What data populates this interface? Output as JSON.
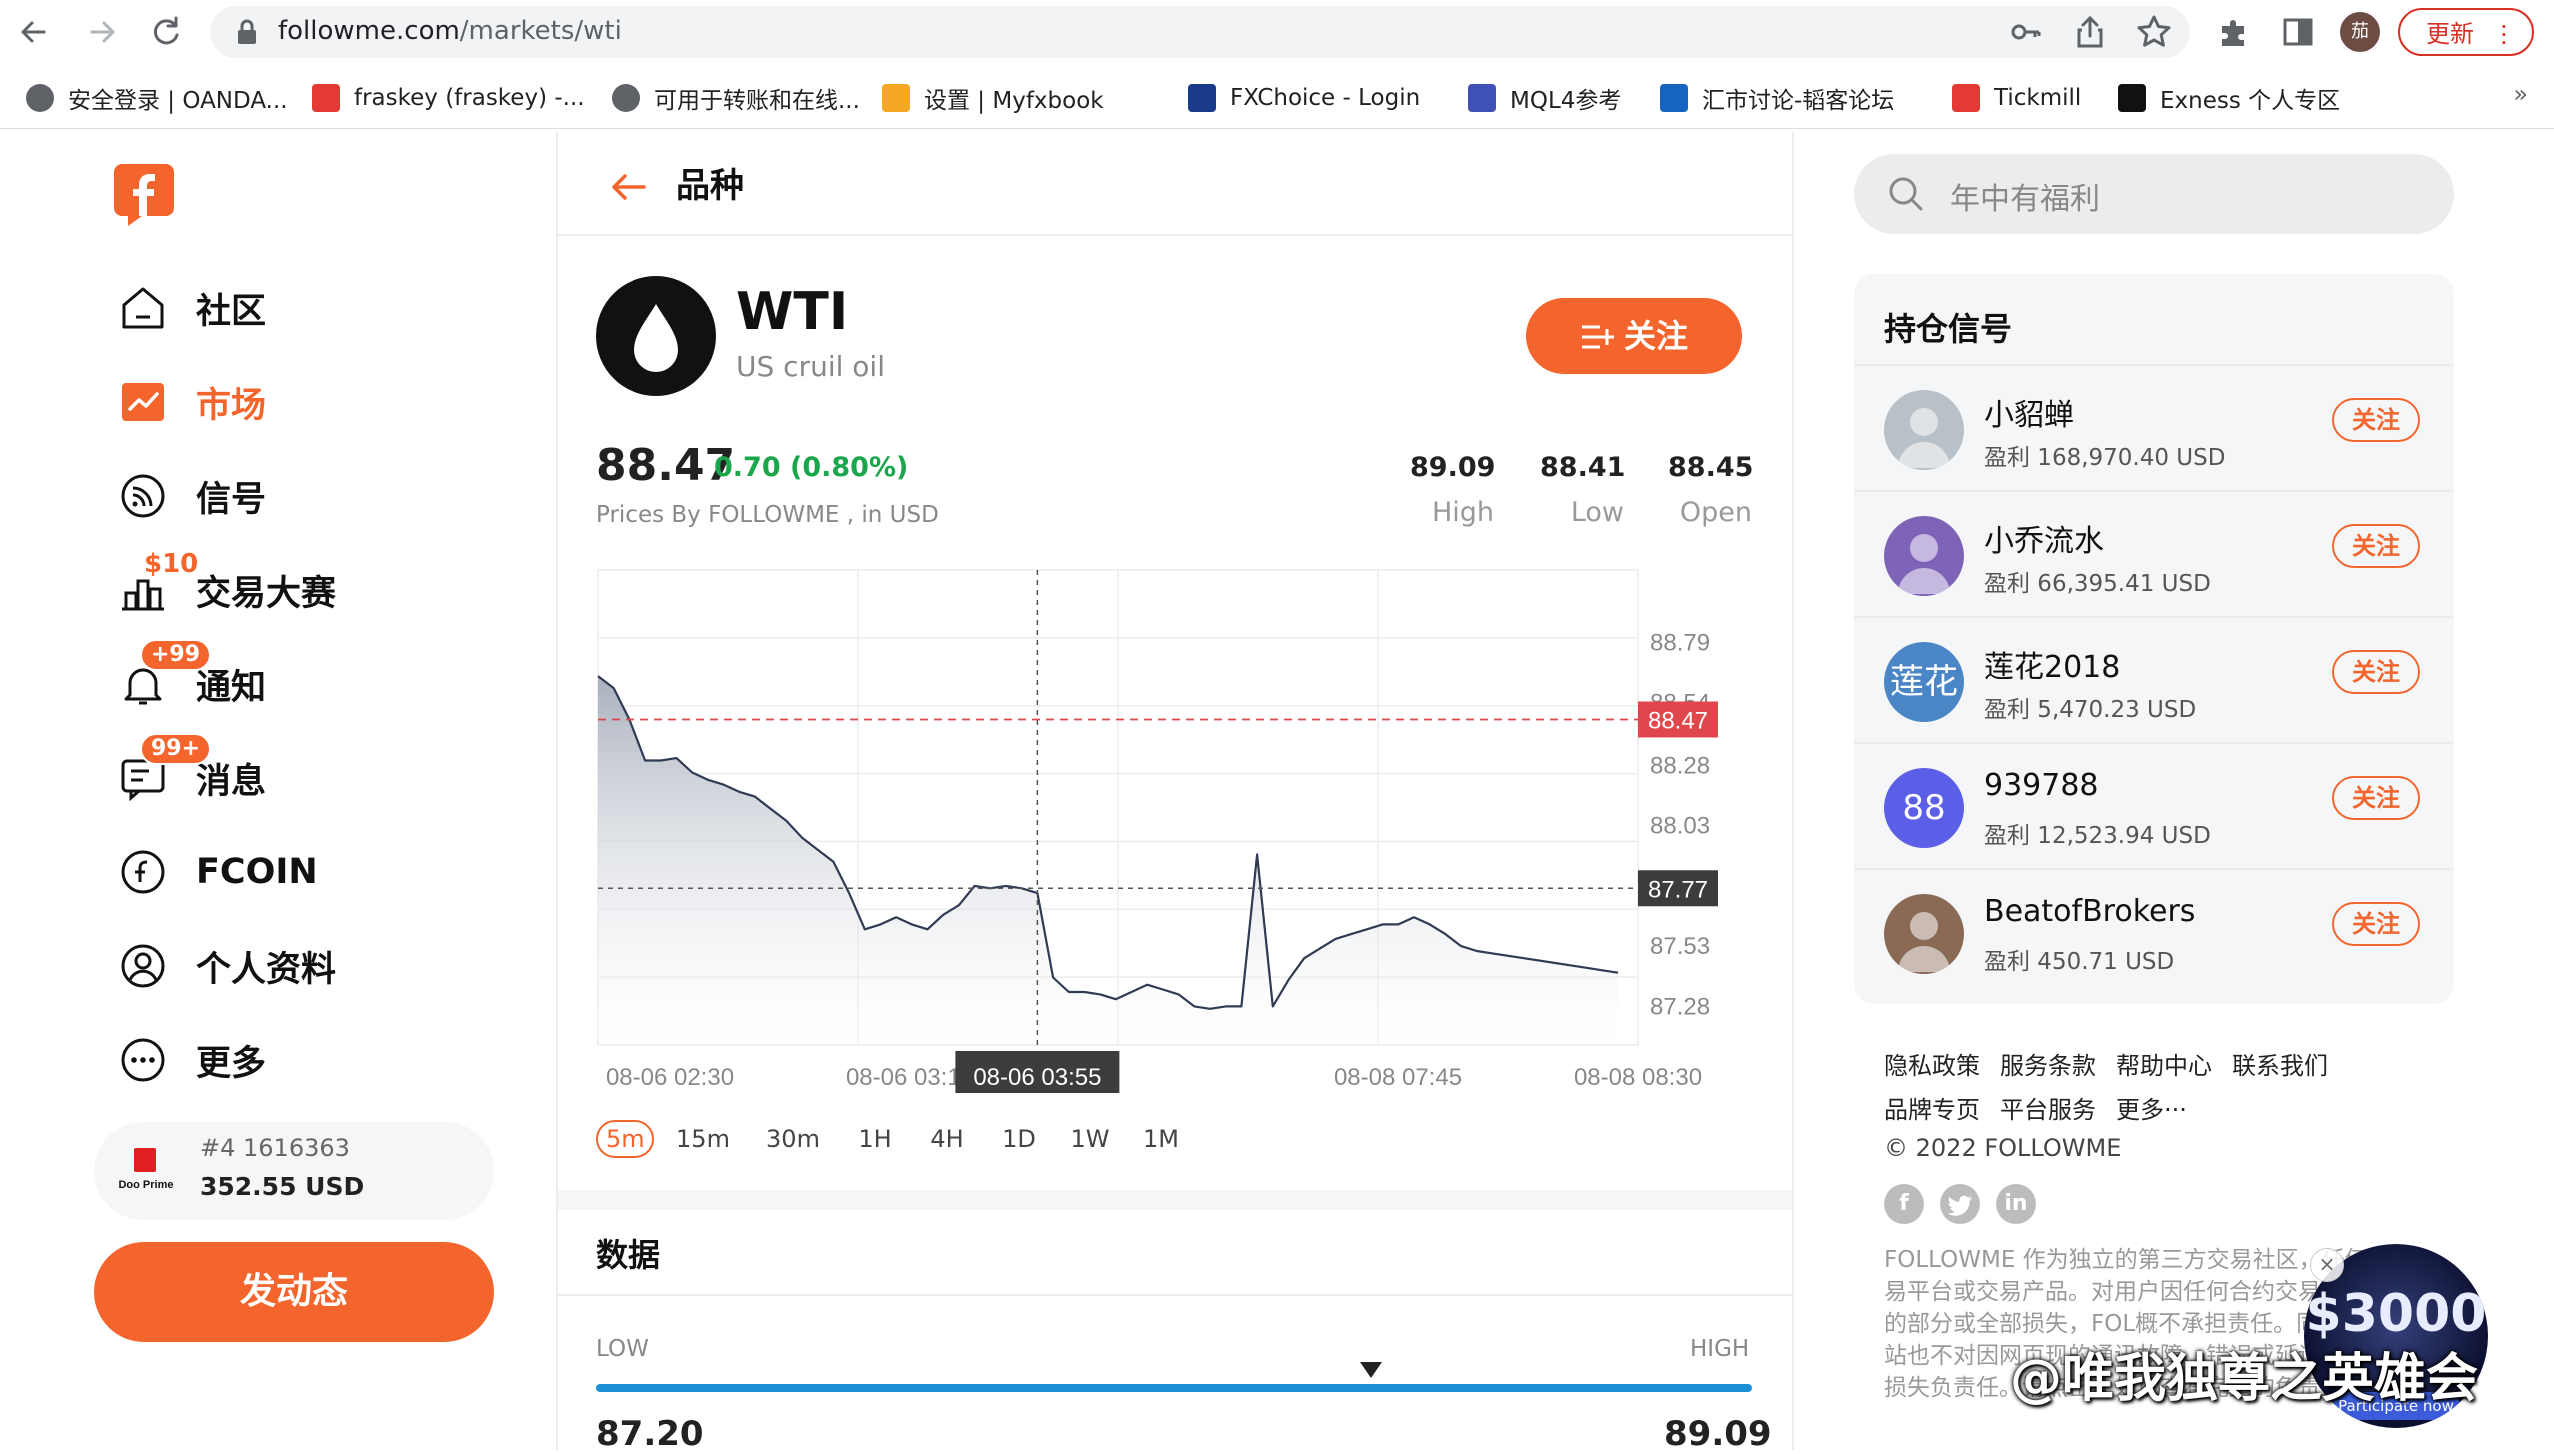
{
  "browser": {
    "url_host": "followme.com",
    "url_path": "/markets/wti",
    "profile_initial": "茄",
    "update_label": "更新",
    "bookmarks": [
      {
        "label": "安全登录 | OANDA...",
        "icon": "globe-icon",
        "color": "#5f6368"
      },
      {
        "label": "fraskey (fraskey) -...",
        "icon": "fraskey-icon",
        "color": "#e53935"
      },
      {
        "label": "可用于转账和在线...",
        "icon": "globe-icon",
        "color": "#5f6368"
      },
      {
        "label": "设置 | Myfxbook",
        "icon": "myfxbook-icon",
        "color": "#f5a623"
      },
      {
        "label": "FXChoice - Login",
        "icon": "fxchoice-icon",
        "color": "#1a3a8a"
      },
      {
        "label": "MQL4参考",
        "icon": "mql4-icon",
        "color": "#3f51b5"
      },
      {
        "label": "汇市讨论-韬客论坛",
        "icon": "taoke-icon",
        "color": "#1565c0"
      },
      {
        "label": "Tickmill",
        "icon": "tickmill-icon",
        "color": "#e53935"
      },
      {
        "label": "Exness 个人专区",
        "icon": "exness-icon",
        "color": "#111111"
      }
    ],
    "bookmarks_more": "»"
  },
  "sidebar": {
    "items": [
      {
        "label": "社区",
        "icon": "home-icon"
      },
      {
        "label": "市场",
        "icon": "market-chart-icon",
        "active": true
      },
      {
        "label": "信号",
        "icon": "signal-icon"
      },
      {
        "label": "交易大赛",
        "icon": "contest-icon",
        "badge": "$10"
      },
      {
        "label": "通知",
        "icon": "bell-icon",
        "badge": "+99"
      },
      {
        "label": "消息",
        "icon": "message-icon",
        "badge": "99+"
      },
      {
        "label": "FCOIN",
        "icon": "fcoin-icon"
      },
      {
        "label": "个人资料",
        "icon": "profile-icon"
      },
      {
        "label": "更多",
        "icon": "more-icon"
      }
    ],
    "broker_card": {
      "rank": "#4  1616363",
      "value": "352.55 USD",
      "logo_text": "Doo Prime"
    },
    "post_button": "发动态"
  },
  "main": {
    "title": "品种",
    "symbol": {
      "name": "WTI",
      "description": "US cruil oil",
      "follow_label": "关注"
    },
    "quote": {
      "price": "88.47",
      "change": "0.70 (0.80%)",
      "source": "Prices By FOLLOWME , in USD",
      "stats": [
        {
          "value": "89.09",
          "label": "High"
        },
        {
          "value": "88.41",
          "label": "Low"
        },
        {
          "value": "88.45",
          "label": "Open"
        }
      ]
    },
    "timeframes": [
      "5m",
      "15m",
      "30m",
      "1H",
      "4H",
      "1D",
      "1W",
      "1M"
    ],
    "active_timeframe": "5m",
    "data_section": {
      "title": "数据",
      "low_label": "LOW",
      "high_label": "HIGH",
      "low": "87.20",
      "high": "89.09",
      "current_fraction": 0.67
    }
  },
  "chart_data": {
    "type": "area",
    "y_ticks": [
      "88.79",
      "88.54",
      "88.28",
      "88.03",
      "87.53",
      "87.28"
    ],
    "x_tick_labels": [
      "08-06 02:30",
      "08-06 03:15",
      "08-06 03:55",
      "08-08 07:45",
      "08-08 08:30"
    ],
    "ylim": [
      87.12,
      89.09
    ],
    "x": [
      0,
      1,
      2,
      3,
      4,
      5,
      6,
      7,
      8,
      9,
      10,
      11,
      12,
      13,
      14,
      15,
      16,
      17,
      18,
      19,
      20,
      21,
      22,
      23,
      24,
      25,
      26,
      27,
      28,
      29,
      30,
      31,
      32,
      33,
      34,
      35,
      36,
      37,
      38,
      39,
      40,
      41,
      42,
      43,
      44,
      45,
      46,
      47,
      48,
      49,
      50,
      51,
      52,
      53,
      54,
      55,
      56,
      57,
      58,
      59,
      60,
      61,
      62,
      63,
      64,
      65
    ],
    "values": [
      88.65,
      88.6,
      88.47,
      88.3,
      88.3,
      88.31,
      88.25,
      88.22,
      88.2,
      88.17,
      88.15,
      88.1,
      88.05,
      87.98,
      87.93,
      87.88,
      87.75,
      87.6,
      87.62,
      87.65,
      87.62,
      87.6,
      87.66,
      87.7,
      87.78,
      87.77,
      87.78,
      87.77,
      87.75,
      87.4,
      87.34,
      87.34,
      87.33,
      87.31,
      87.34,
      87.37,
      87.35,
      87.33,
      87.28,
      87.27,
      87.28,
      87.28,
      87.91,
      87.28,
      87.39,
      87.48,
      87.52,
      87.56,
      87.58,
      87.6,
      87.62,
      87.62,
      87.65,
      87.62,
      87.58,
      87.53,
      87.51,
      87.5,
      87.49,
      87.48,
      87.47,
      87.46,
      87.45,
      87.44,
      87.43,
      87.42
    ],
    "current_price": "88.47",
    "crosshair_price": "87.77",
    "crosshair_time": "08-06 03:55",
    "grid": true,
    "colors": {
      "line": "#2f3b52",
      "fill_top": "#a9b0bd",
      "current_line": "#e0474c",
      "crosshair": "#555555"
    }
  },
  "right": {
    "search_placeholder": "年中有福利",
    "signals_title": "持仓信号",
    "signals": [
      {
        "name": "小貂蝉",
        "pnl": "盈利 168,970.40 USD",
        "avatar_color": "#b8c0c8",
        "avatar_text": ""
      },
      {
        "name": "小乔流水",
        "pnl": "盈利 66,395.41 USD",
        "avatar_color": "#7e64b8",
        "avatar_text": ""
      },
      {
        "name": "莲花2018",
        "pnl": "盈利 5,470.23 USD",
        "avatar_color": "#4a86c5",
        "avatar_text": "莲花"
      },
      {
        "name": "939788",
        "pnl": "盈利 12,523.94 USD",
        "avatar_color": "#5b5ee6",
        "avatar_text": "88"
      },
      {
        "name": "BeatofBrokers",
        "pnl": "盈利 450.71 USD",
        "avatar_color": "#8a6a55",
        "avatar_text": ""
      }
    ],
    "follow_label": "关注",
    "footer_links_row1": [
      "隐私政策",
      "服务条款",
      "帮助中心",
      "联系我们"
    ],
    "footer_links_row2": [
      "品牌专页",
      "平台服务",
      "更多···"
    ],
    "copyright": "© 2022 FOLLOWME",
    "social": [
      "facebook-icon",
      "twitter-icon",
      "linkedin-icon"
    ],
    "disclaimer": "FOLLOWME 作为独立的第三方交易社区，任何交易平台或交易产品。对用户因任何合约交易而产生的部分或全部损失，FOL概不承担责任。同时，本站也不对因网页现的通讯故障、错误或延误造成的损失负责任。请点击此处以查看完整的免责声明。",
    "promo": {
      "amount": "$3000",
      "cta": "Participate now",
      "close": "×"
    },
    "watermark": "@唯我独尊之英雄会"
  }
}
